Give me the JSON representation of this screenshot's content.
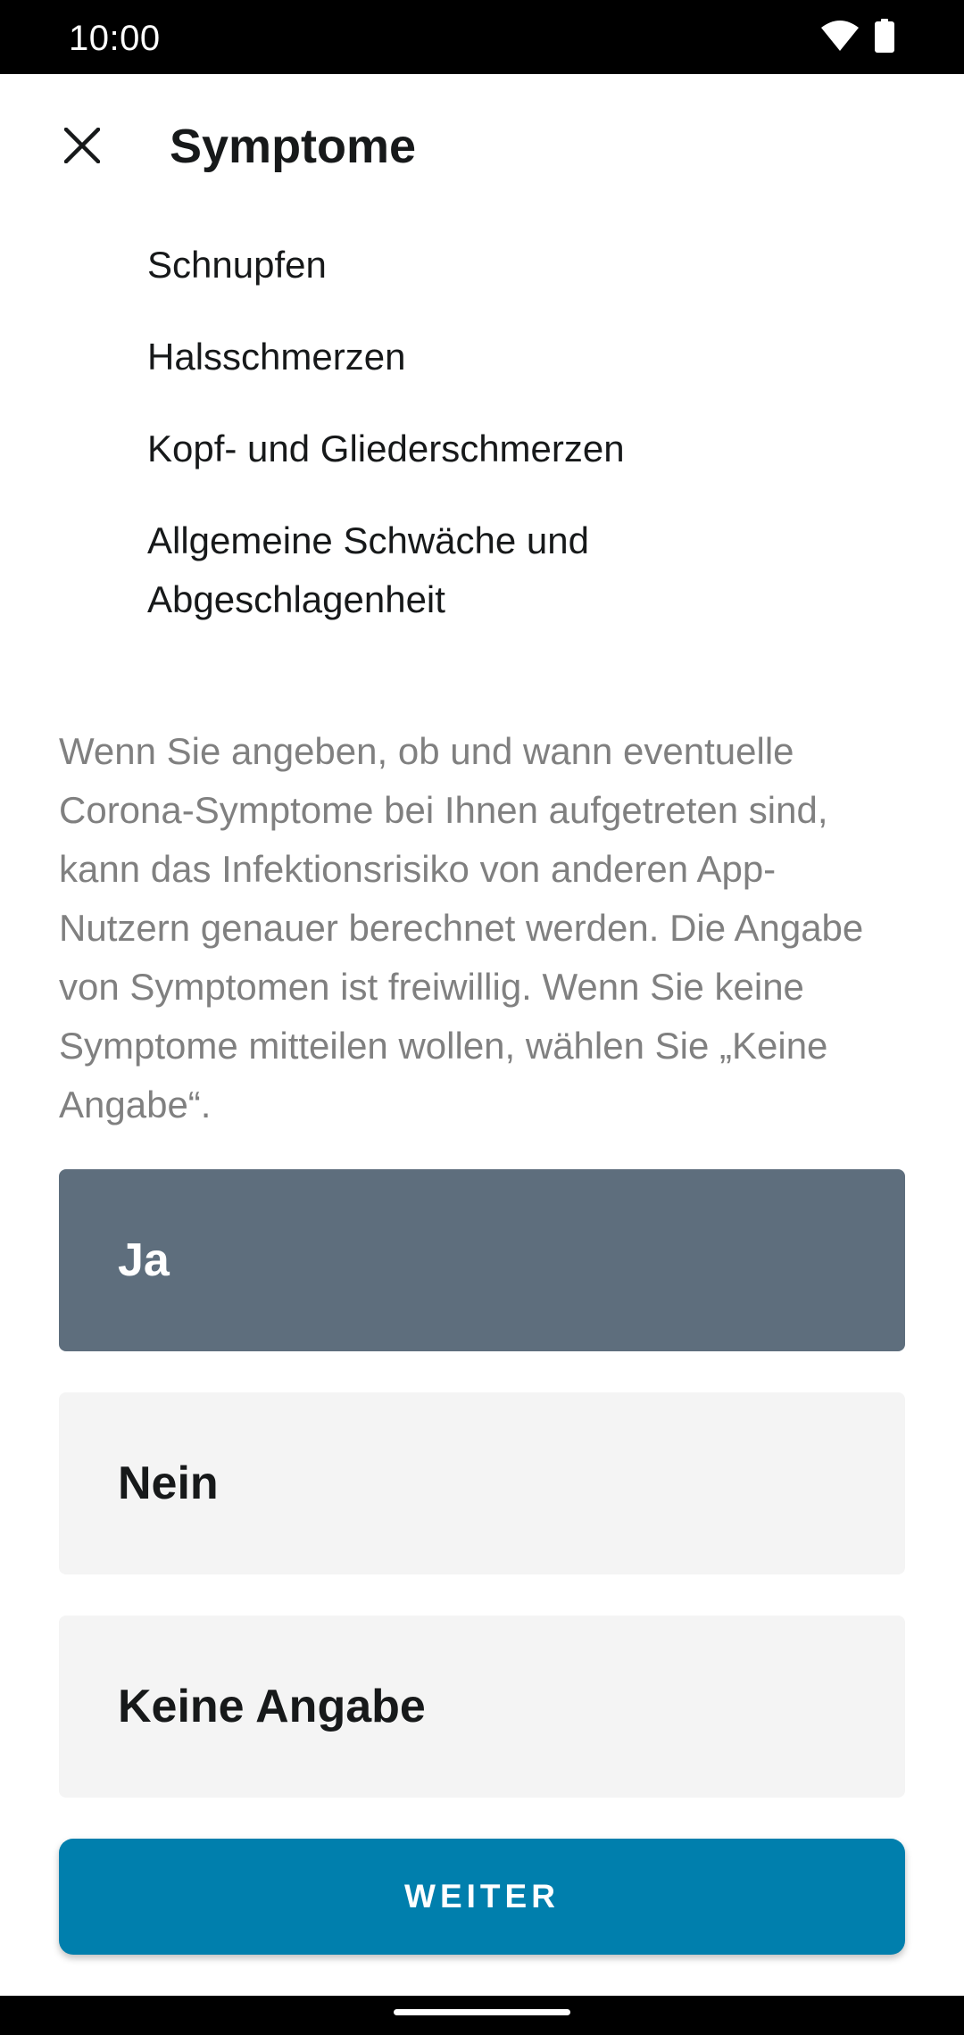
{
  "status_bar": {
    "time": "10:00",
    "icons": [
      "wifi-icon",
      "battery-icon"
    ]
  },
  "app_bar": {
    "close_icon": "close-icon",
    "title": "Symptome"
  },
  "symptoms": [
    "Schnupfen",
    "Halsschmerzen",
    "Kopf- und Gliederschmerzen",
    "Allgemeine Schwäche und Abgeschlagenheit"
  ],
  "info_text": "Wenn Sie angeben, ob und wann eventuelle Corona-Symptome bei Ihnen aufgetreten sind, kann das Infektionsrisiko von anderen App-Nutzern genauer berechnet werden. Die Angabe von Symptomen ist freiwillig. Wenn Sie keine Symptome mitteilen wollen, wählen Sie „Keine Angabe“.",
  "options": {
    "yes": "Ja",
    "no": "Nein",
    "none": "Keine Angabe",
    "selected": "yes"
  },
  "continue_button": "WEITER",
  "colors": {
    "selected_option": "#5e6e7d",
    "unselected_option": "#f4f4f4",
    "primary_button": "#007fad",
    "body_text": "#17191a",
    "secondary_text": "#808080"
  }
}
